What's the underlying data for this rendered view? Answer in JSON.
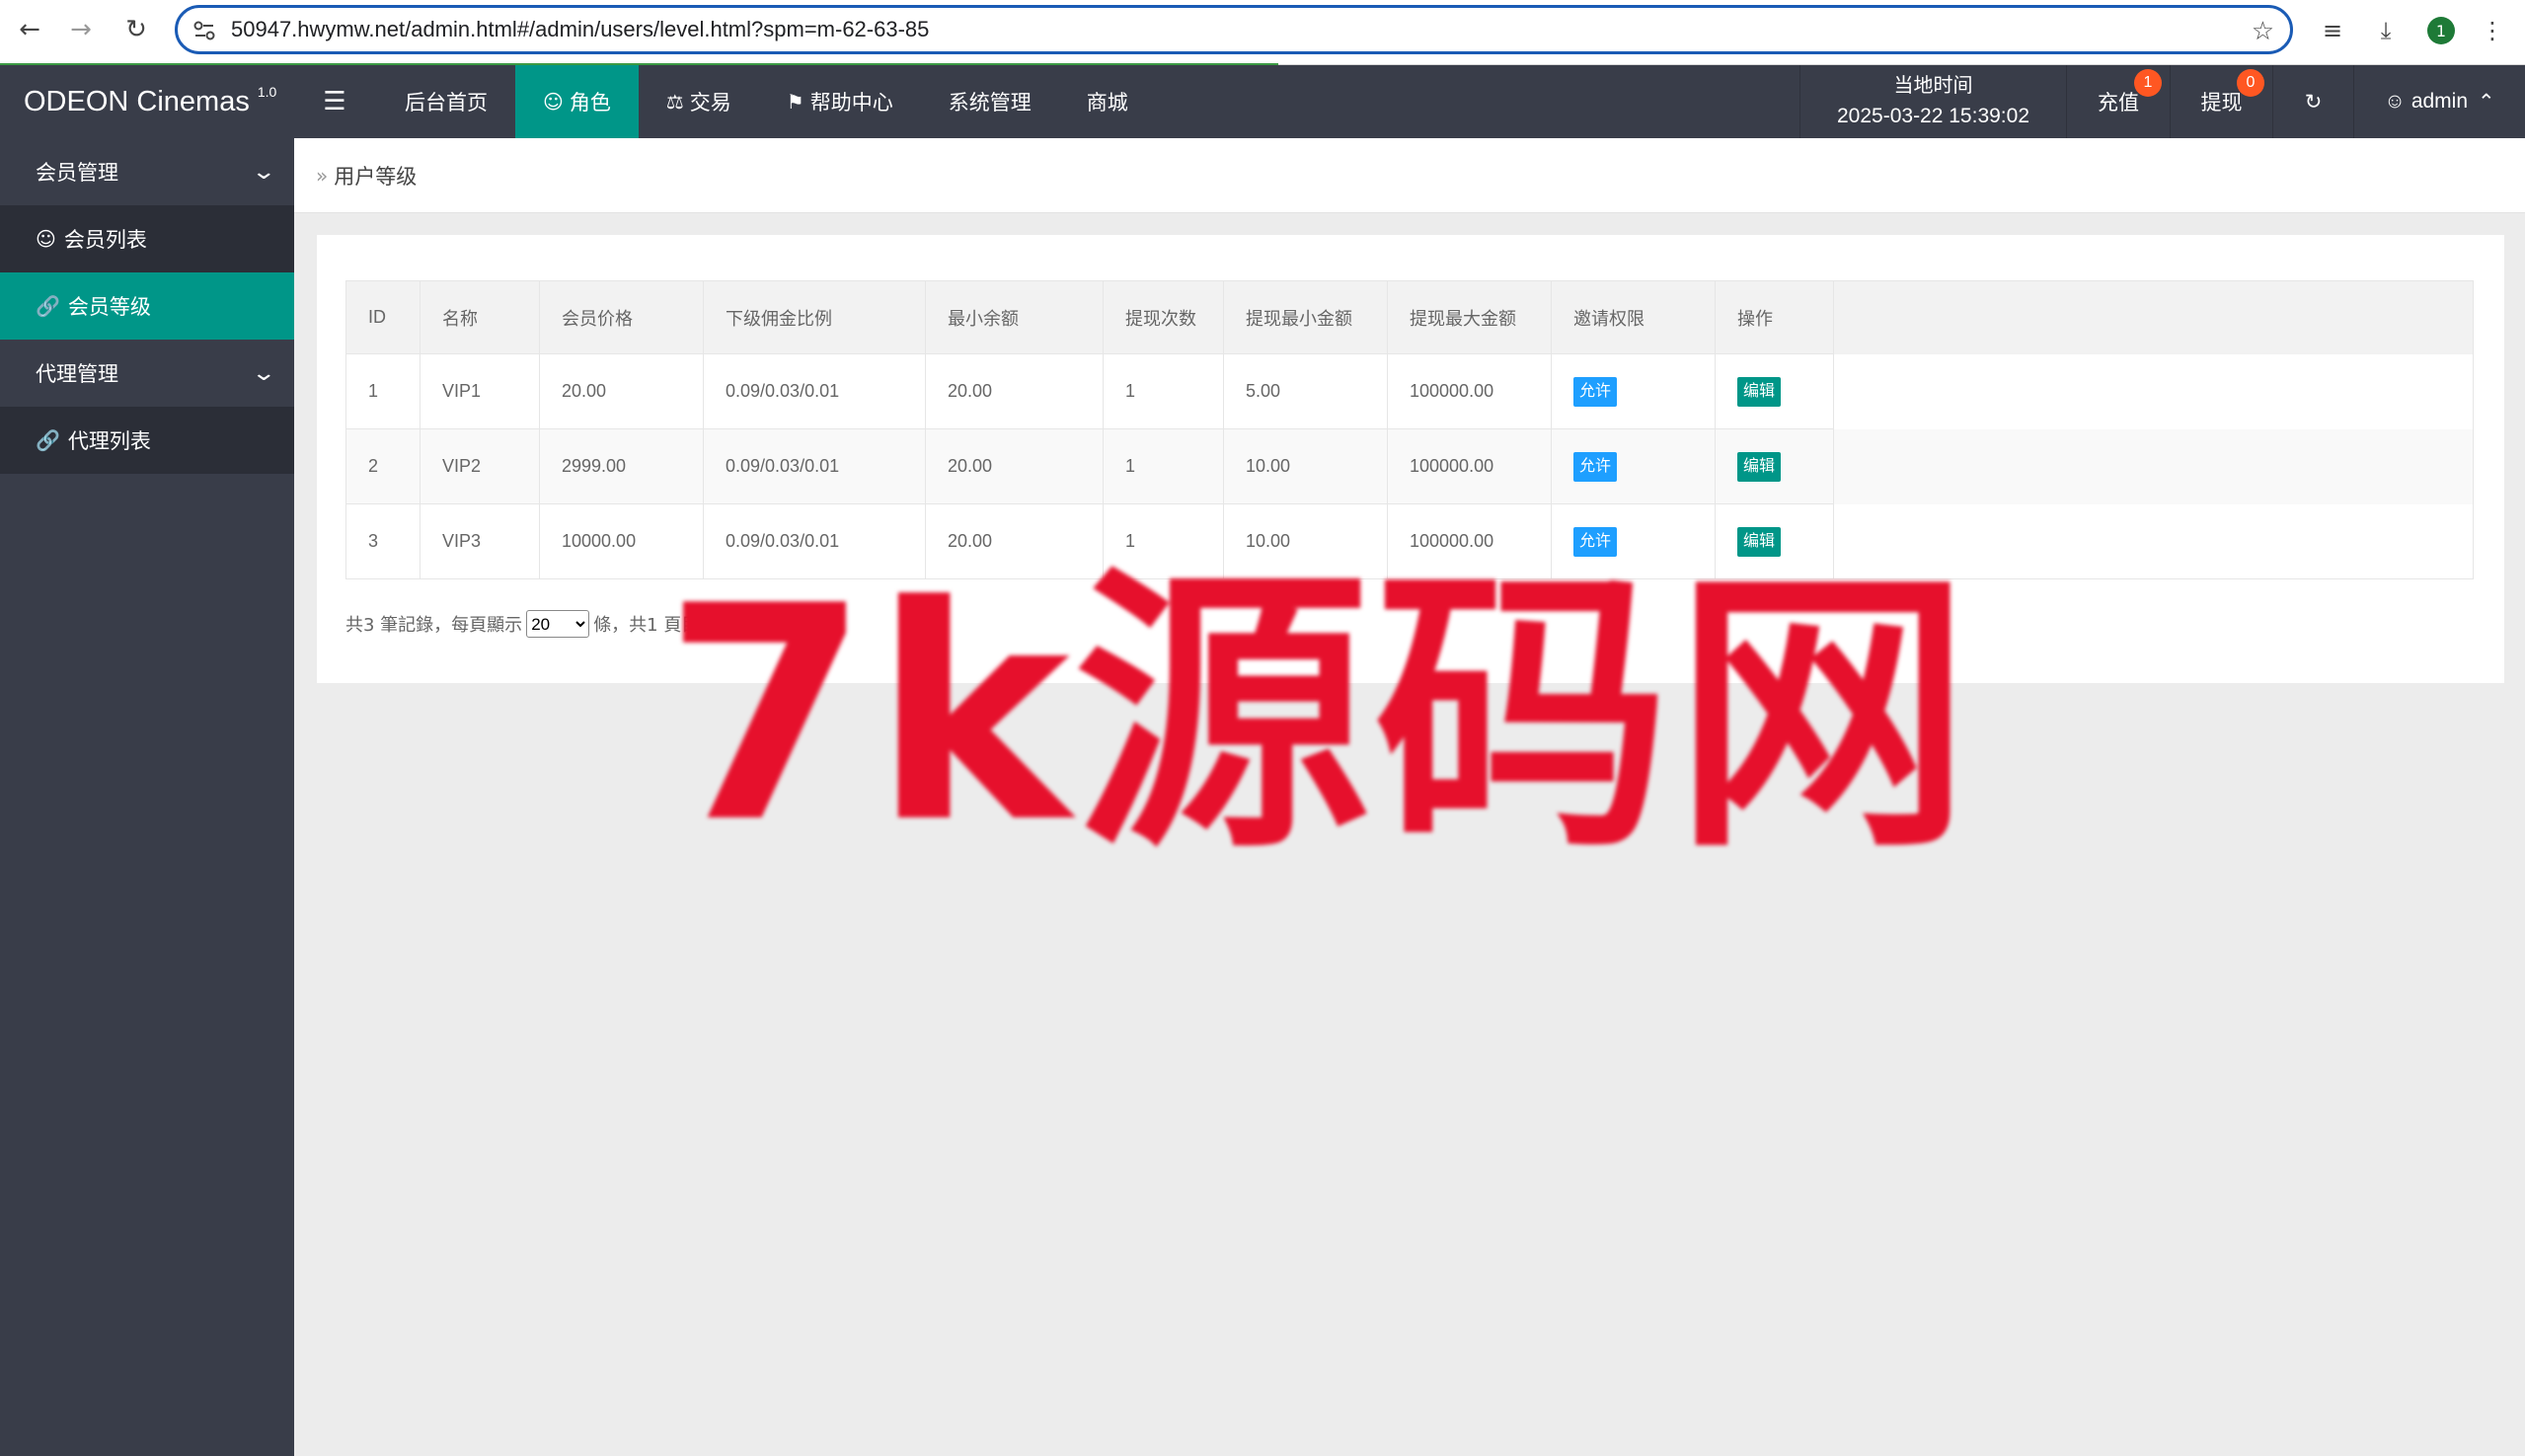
{
  "browser": {
    "url": "50947.hwymw.net/admin.html#/admin/users/level.html?spm=m-62-63-85",
    "profile_initial": "1"
  },
  "header": {
    "logo_text": "ODEON Cinemas",
    "logo_version": "1.0",
    "nav": [
      {
        "label": "后台首页",
        "icon": ""
      },
      {
        "label": "角色",
        "icon": "user-icon",
        "active": true
      },
      {
        "label": "交易",
        "icon": "scale-icon"
      },
      {
        "label": "帮助中心",
        "icon": "flag-icon"
      },
      {
        "label": "系统管理",
        "icon": ""
      },
      {
        "label": "商城",
        "icon": ""
      }
    ],
    "time_label": "当地时间",
    "time_value": "2025-03-22 15:39:02",
    "recharge_label": "充值",
    "recharge_badge": "1",
    "withdraw_label": "提现",
    "withdraw_badge": "0",
    "admin_label": "admin"
  },
  "sidebar": {
    "group1": "会员管理",
    "item1": "会员列表",
    "item2": "会员等级",
    "group2": "代理管理",
    "item3": "代理列表"
  },
  "breadcrumb": "用户等级",
  "table": {
    "headers": [
      "ID",
      "名称",
      "会员价格",
      "下级佣金比例",
      "最小余额",
      "提现次数",
      "提现最小金额",
      "提现最大金额",
      "邀请权限",
      "操作"
    ],
    "rows": [
      [
        "1",
        "VIP1",
        "20.00",
        "0.09/0.03/0.01",
        "20.00",
        "1",
        "5.00",
        "100000.00",
        "允许",
        "编辑"
      ],
      [
        "2",
        "VIP2",
        "2999.00",
        "0.09/0.03/0.01",
        "20.00",
        "1",
        "10.00",
        "100000.00",
        "允许",
        "编辑"
      ],
      [
        "3",
        "VIP3",
        "10000.00",
        "0.09/0.03/0.01",
        "20.00",
        "1",
        "10.00",
        "100000.00",
        "允许",
        "编辑"
      ]
    ]
  },
  "pager": {
    "prefix": "共3 筆記錄，每頁顯示",
    "page_size": "20",
    "suffix": "條，共1 頁目前顯示第1 頁。"
  },
  "watermark": "7k源码网",
  "colors": {
    "header_bg": "#393d49",
    "accent": "#009688",
    "badge": "#ff5722",
    "allow_btn": "#1e9fff"
  }
}
